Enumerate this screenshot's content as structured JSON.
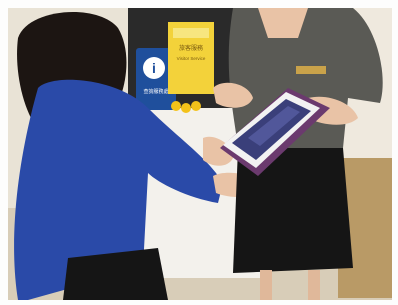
{
  "photo": {
    "subject": "photo",
    "signs": {
      "info_symbol": "i",
      "blue_sign_small_text": "查詢服務處",
      "yellow_poster_lines": [
        "旅客服務",
        "Visitor Service"
      ]
    },
    "tablet": {
      "screen_color": "#3a3f7a",
      "case_color": "#6b3a6e"
    },
    "colors": {
      "blue_shirt": "#2a4aa8",
      "hair": "#1c1512",
      "checked_uniform": "#5a5a55",
      "black_skirt": "#151515",
      "skin": "#e9c3a6",
      "floor": "#d8cdb8"
    }
  }
}
